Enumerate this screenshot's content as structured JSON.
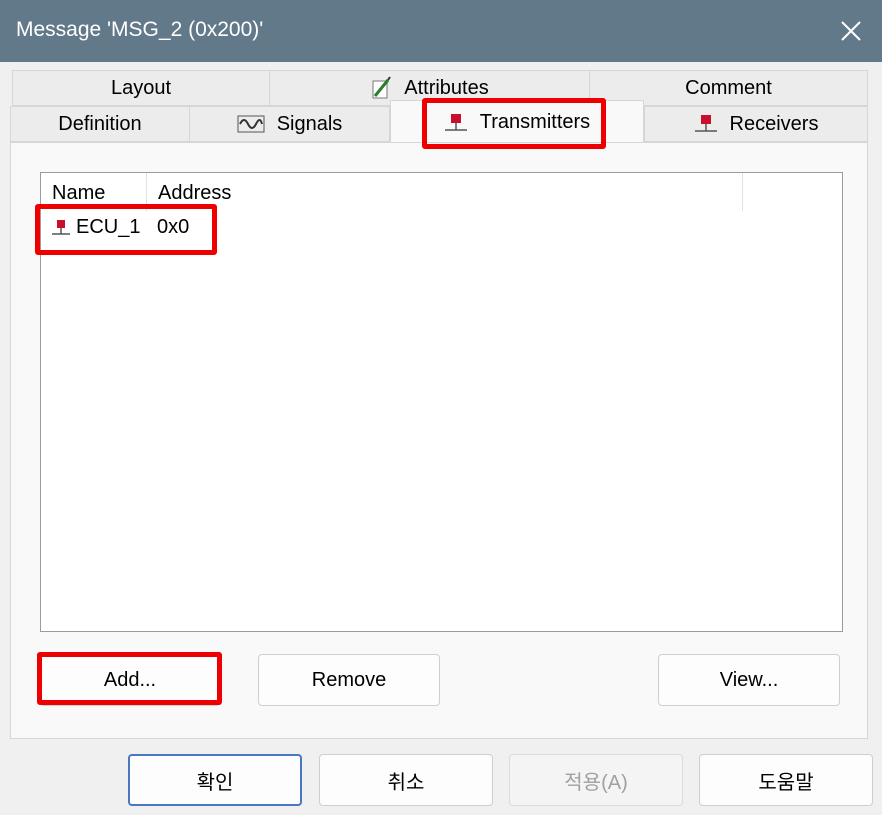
{
  "window": {
    "title": "Message 'MSG_2 (0x200)'"
  },
  "tabs_row1": [
    {
      "label": "Layout"
    },
    {
      "label": "Attributes",
      "icon": "pencil-icon"
    },
    {
      "label": "Comment"
    }
  ],
  "tabs_row2": [
    {
      "label": "Definition"
    },
    {
      "label": "Signals",
      "icon": "signal-wave-icon"
    },
    {
      "label": "Transmitters",
      "icon": "node-icon",
      "active": true
    },
    {
      "label": "Receivers",
      "icon": "node-icon"
    }
  ],
  "list": {
    "columns": [
      "Name",
      "Address"
    ],
    "rows": [
      {
        "name": "ECU_1",
        "address": "0x0",
        "icon": "node-icon"
      }
    ]
  },
  "buttons": {
    "add": "Add...",
    "remove": "Remove",
    "view": "View..."
  },
  "footer": {
    "ok": "확인",
    "cancel": "취소",
    "apply": "적용(A)",
    "help": "도움말"
  },
  "colors": {
    "titlebar": "#62798a",
    "highlight": "#ee0000",
    "node_icon": "#c8102e"
  }
}
